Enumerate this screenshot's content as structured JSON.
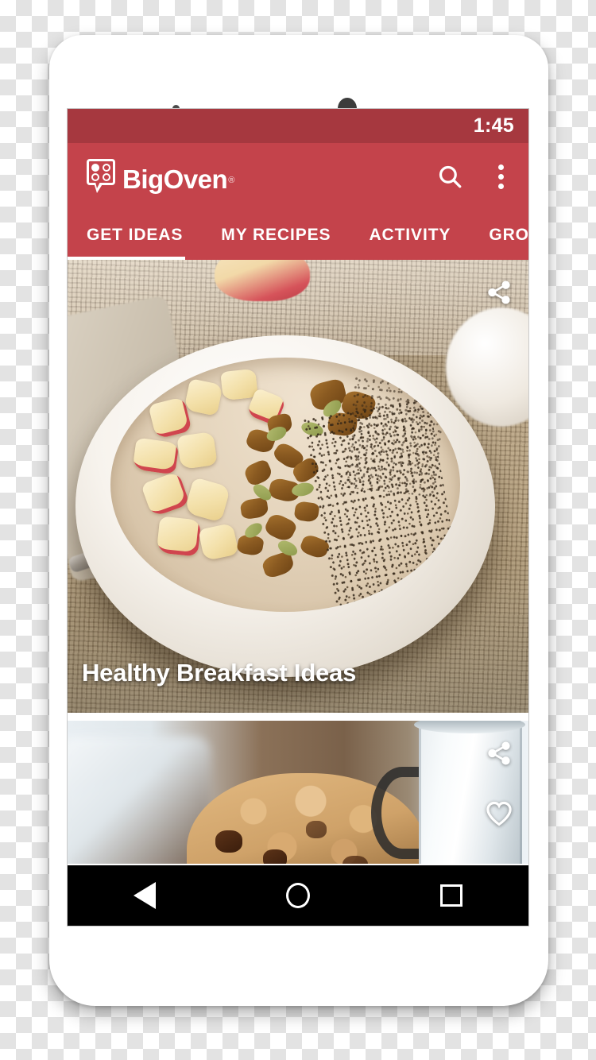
{
  "status_bar": {
    "time": "1:45"
  },
  "app_bar": {
    "brand_name": "BigOven",
    "registered_mark": "®",
    "logo_icon": "bigoven-logo-icon",
    "search_icon": "search-icon",
    "overflow_icon": "overflow-menu-icon"
  },
  "tabs": [
    {
      "label": "GET IDEAS",
      "active": true
    },
    {
      "label": "MY RECIPES",
      "active": false
    },
    {
      "label": "ACTIVITY",
      "active": false
    },
    {
      "label": "GROCE",
      "active": false
    }
  ],
  "feed": {
    "cards": [
      {
        "title": "Healthy Breakfast Ideas",
        "image_description": "smoothie bowl with apple chunks, granola and chia seeds on burlap",
        "share_icon": "share-icon",
        "favorite_icon": "heart-icon"
      },
      {
        "title": "",
        "image_description": "oatmeal chocolate chip cookie beside a milk jug",
        "share_icon": "share-icon",
        "favorite_icon": "heart-icon"
      }
    ]
  },
  "nav_bar": {
    "back_icon": "back-triangle-icon",
    "home_icon": "home-circle-icon",
    "recents_icon": "recents-square-icon"
  },
  "colors": {
    "status_bar_red": "#a6383f",
    "app_bar_red": "#c4434b",
    "tab_indicator": "#ffffff",
    "nav_bar": "#000000",
    "phone_body": "#ffffff"
  }
}
